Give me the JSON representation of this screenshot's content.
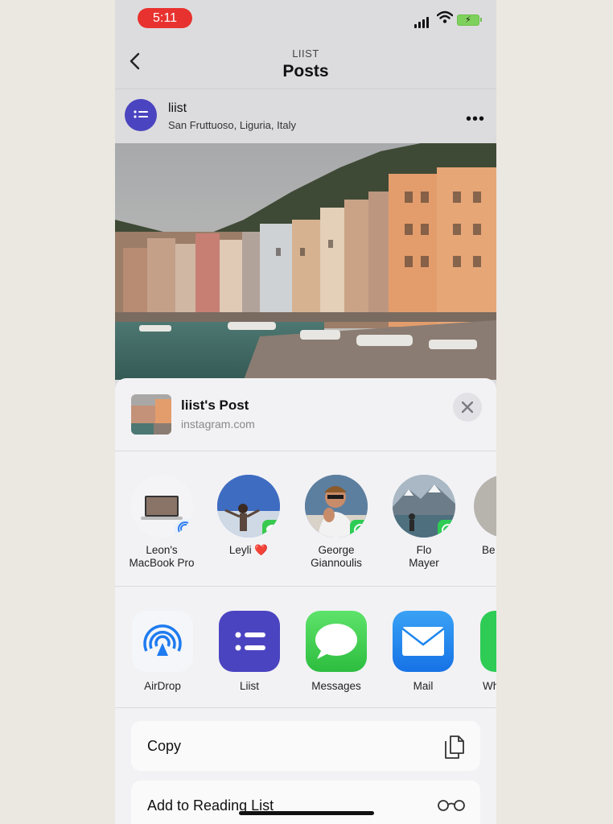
{
  "status_bar": {
    "time": "5:11"
  },
  "header": {
    "subtitle": "LIIST",
    "title": "Posts"
  },
  "post": {
    "account": "liist",
    "location": "San Fruttuoso, Liguria, Italy",
    "more": "•••"
  },
  "share_sheet": {
    "title": "liist's Post",
    "subtitle": "instagram.com",
    "people": [
      {
        "line1": "Leon's",
        "line2": "MacBook Pro",
        "badge": "airdrop-icon"
      },
      {
        "line1": "Leyli ❤️",
        "line2": "",
        "badge": "messages-icon"
      },
      {
        "line1": "George",
        "line2": "Giannoulis",
        "badge": "whatsapp-icon"
      },
      {
        "line1": "Flo",
        "line2": "Mayer",
        "badge": "whatsapp-icon"
      },
      {
        "line1": "Be",
        "line2": ""
      }
    ],
    "apps": [
      {
        "label": "AirDrop",
        "icon": "airdrop-icon"
      },
      {
        "label": "Liist",
        "icon": "liist-icon"
      },
      {
        "label": "Messages",
        "icon": "messages-icon"
      },
      {
        "label": "Mail",
        "icon": "mail-icon"
      },
      {
        "label": "Wh",
        "icon": "whatsapp-icon"
      }
    ],
    "actions": [
      {
        "label": "Copy",
        "icon": "copy-icon"
      },
      {
        "label": "Add to Reading List",
        "icon": "glasses-icon"
      }
    ]
  },
  "colors": {
    "accent_purple": "#4b44c0",
    "time_pill": "#e8322f",
    "whatsapp": "#2ecc55"
  }
}
